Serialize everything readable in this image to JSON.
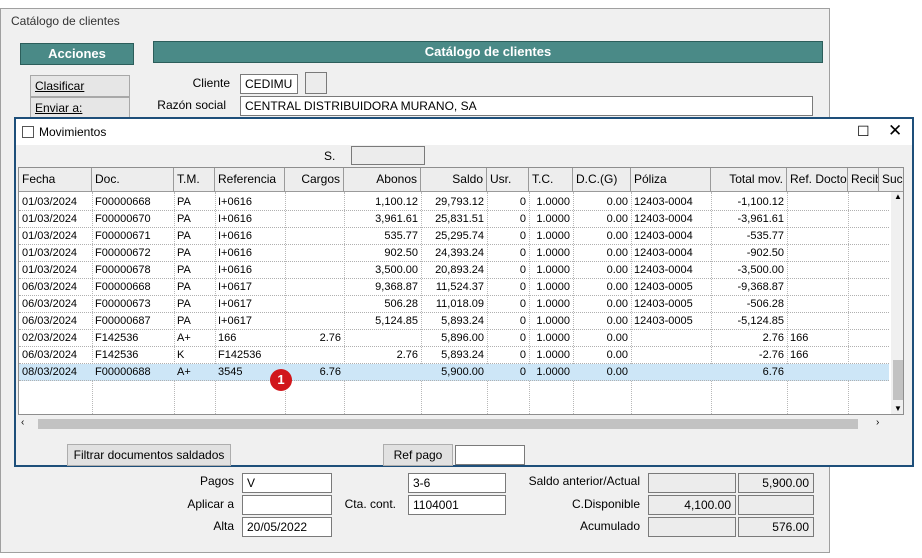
{
  "background_window": {
    "title": "Catálogo de clientes",
    "actions_header": "Acciones",
    "catalog_header": "Catálogo de clientes",
    "side_buttons": [
      "Clasificar",
      "Enviar a:"
    ],
    "client": {
      "label": "Cliente",
      "value": "CEDIMU"
    },
    "razon_social": {
      "label": "Razón social",
      "value": "CENTRAL DISTRIBUIDORA MURANO, SA"
    },
    "pagos": {
      "label": "Pagos",
      "value": "V"
    },
    "aplicar_a": {
      "label": "Aplicar a",
      "value": ""
    },
    "alta": {
      "label": "Alta",
      "value": "20/05/2022"
    },
    "pagos_range": {
      "value": "3-6"
    },
    "cta_cont": {
      "label": "Cta. cont.",
      "value": "1104001"
    },
    "saldo_anterior": {
      "label": "Saldo anterior/Actual",
      "value": "5,900.00"
    },
    "c_disponible": {
      "label": "C.Disponible",
      "value": "4,100.00"
    },
    "acumulado": {
      "label": "Acumulado",
      "value": "576.00"
    }
  },
  "dialog": {
    "title": "Movimientos",
    "s_label": "S.",
    "columns": [
      "Fecha",
      "Doc.",
      "T.M.",
      "Referencia",
      "Cargos",
      "Abonos",
      "Saldo",
      "Usr.",
      "T.C.",
      "D.C.(G)",
      "Póliza",
      "Total mov.",
      "Ref. Docto",
      "Recib",
      "Sucu"
    ],
    "rows": [
      [
        "01/03/2024",
        "F00000668",
        "PA",
        "I+0616",
        "",
        "1,100.12",
        "29,793.12",
        "0",
        "1.0000",
        "0.00",
        "12403-0004",
        "-1,100.12",
        ""
      ],
      [
        "01/03/2024",
        "F00000670",
        "PA",
        "I+0616",
        "",
        "3,961.61",
        "25,831.51",
        "0",
        "1.0000",
        "0.00",
        "12403-0004",
        "-3,961.61",
        ""
      ],
      [
        "01/03/2024",
        "F00000671",
        "PA",
        "I+0616",
        "",
        "535.77",
        "25,295.74",
        "0",
        "1.0000",
        "0.00",
        "12403-0004",
        "-535.77",
        ""
      ],
      [
        "01/03/2024",
        "F00000672",
        "PA",
        "I+0616",
        "",
        "902.50",
        "24,393.24",
        "0",
        "1.0000",
        "0.00",
        "12403-0004",
        "-902.50",
        ""
      ],
      [
        "01/03/2024",
        "F00000678",
        "PA",
        "I+0616",
        "",
        "3,500.00",
        "20,893.24",
        "0",
        "1.0000",
        "0.00",
        "12403-0004",
        "-3,500.00",
        ""
      ],
      [
        "06/03/2024",
        "F00000668",
        "PA",
        "I+0617",
        "",
        "9,368.87",
        "11,524.37",
        "0",
        "1.0000",
        "0.00",
        "12403-0005",
        "-9,368.87",
        ""
      ],
      [
        "06/03/2024",
        "F00000673",
        "PA",
        "I+0617",
        "",
        "506.28",
        "11,018.09",
        "0",
        "1.0000",
        "0.00",
        "12403-0005",
        "-506.28",
        ""
      ],
      [
        "06/03/2024",
        "F00000687",
        "PA",
        "I+0617",
        "",
        "5,124.85",
        "5,893.24",
        "0",
        "1.0000",
        "0.00",
        "12403-0005",
        "-5,124.85",
        ""
      ],
      [
        "02/03/2024",
        "F142536",
        "A+",
        "166",
        "2.76",
        "",
        "5,896.00",
        "0",
        "1.0000",
        "0.00",
        "",
        "2.76",
        "166"
      ],
      [
        "06/03/2024",
        "F142536",
        "K",
        "F142536",
        "",
        "2.76",
        "5,893.24",
        "0",
        "1.0000",
        "0.00",
        "",
        "-2.76",
        "166"
      ],
      [
        "08/03/2024",
        "F00000688",
        "A+",
        "3545",
        "6.76",
        "",
        "5,900.00",
        "0",
        "1.0000",
        "0.00",
        "",
        "6.76",
        ""
      ]
    ],
    "filter_button": "Filtrar  documentos saldados",
    "ref_pago_button": "Ref pago",
    "ref_pago_value": "",
    "badge": "1"
  }
}
